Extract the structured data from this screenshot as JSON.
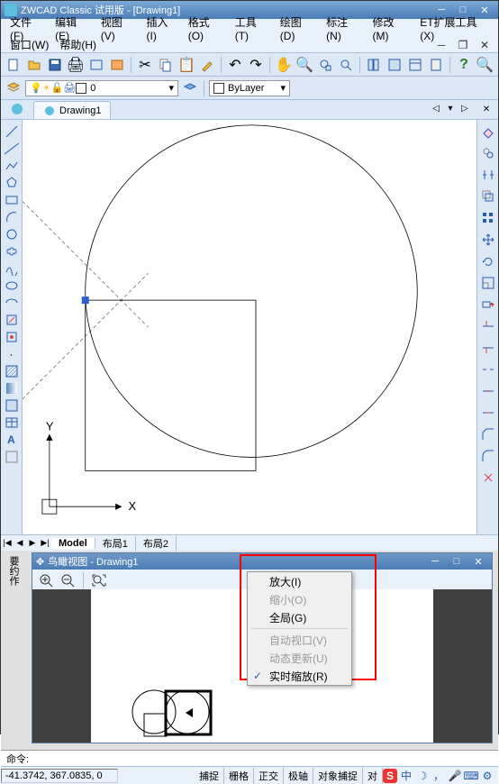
{
  "title": "ZWCAD Classic 试用版 - [Drawing1]",
  "menu": [
    "文件(F)",
    "编辑(E)",
    "视图(V)",
    "插入(I)",
    "格式(O)",
    "工具(T)",
    "绘图(D)",
    "标注(N)",
    "修改(M)",
    "ET扩展工具(X)"
  ],
  "menu2": [
    "窗口(W)",
    "帮助(H)"
  ],
  "doc_tab": "Drawing1",
  "layer": {
    "name": "0",
    "bylayer": "ByLayer"
  },
  "model_tabs": {
    "model": "Model",
    "l1": "布局1",
    "l2": "布局2"
  },
  "aerial": {
    "title": "鸟瞰视图 - Drawing1",
    "sidelabel": "要约作"
  },
  "ctx": {
    "zoom_in": "放大(I)",
    "zoom_out": "缩小(O)",
    "global": "全局(G)",
    "auto_vp": "自动视口(V)",
    "dyn_upd": "动态更新(U)",
    "rt_zoom": "实时缩放(R)"
  },
  "cmd": "命令:",
  "coords": "-41.3742, 367.0835, 0",
  "status": [
    "捕捉",
    "栅格",
    "正交",
    "极轴",
    "对象捕捉",
    "对"
  ],
  "ime_cn": "中",
  "axes": {
    "x": "X",
    "y": "Y"
  }
}
